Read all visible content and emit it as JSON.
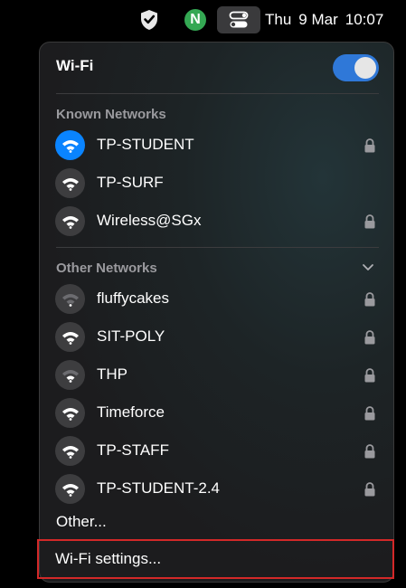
{
  "menubar": {
    "icons": [
      "shield-check-icon",
      "n-app-icon",
      "control-center-icon"
    ],
    "n_letter": "N",
    "day": "Thu",
    "date": "9 Mar",
    "time": "10:07"
  },
  "wifi": {
    "title": "Wi-Fi",
    "enabled": true,
    "accent_color": "#2f78d8",
    "known_label": "Known Networks",
    "known_networks": [
      {
        "name": "TP-STUDENT",
        "connected": true,
        "secured": true
      },
      {
        "name": "TP-SURF",
        "connected": false,
        "secured": false
      },
      {
        "name": "Wireless@SGx",
        "connected": false,
        "secured": true
      }
    ],
    "other_label": "Other Networks",
    "other_networks": [
      {
        "name": "fluffycakes",
        "secured": true
      },
      {
        "name": "SIT-POLY",
        "secured": true
      },
      {
        "name": "THP",
        "secured": true
      },
      {
        "name": "Timeforce",
        "secured": true
      },
      {
        "name": "TP-STAFF",
        "secured": true
      },
      {
        "name": "TP-STUDENT-2.4",
        "secured": true
      }
    ],
    "other_link": "Other...",
    "settings_link": "Wi-Fi settings...",
    "highlight_color": "#d32828"
  }
}
